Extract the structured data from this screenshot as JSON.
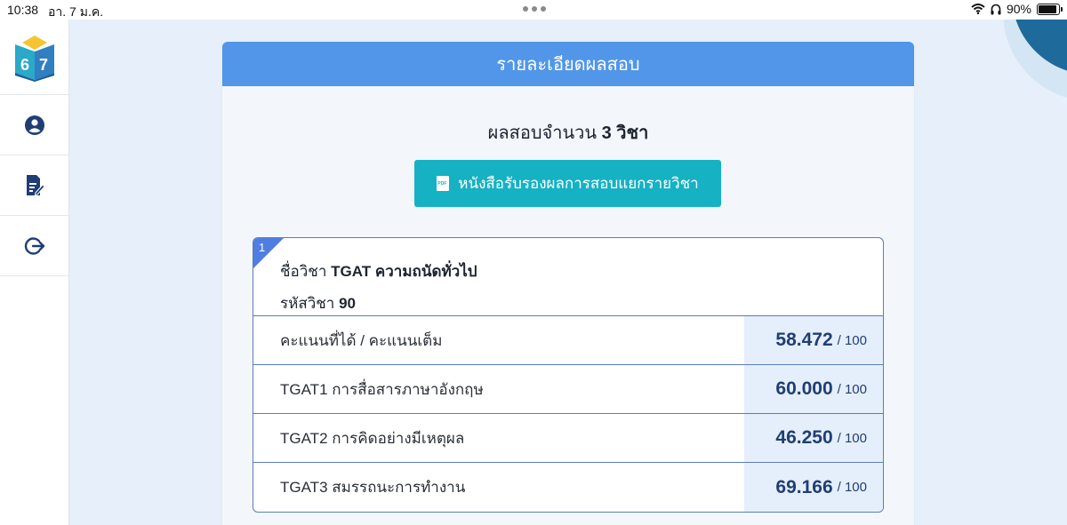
{
  "status_bar": {
    "time": "10:38",
    "date": "อา. 7 ม.ค.",
    "battery": "90%"
  },
  "sidebar": {
    "logo_digits": [
      "6",
      "7"
    ],
    "items": [
      {
        "icon": "user-circle-icon"
      },
      {
        "icon": "document-edit-icon"
      },
      {
        "icon": "logout-icon"
      }
    ]
  },
  "card": {
    "title": "รายละเอียดผลสอบ",
    "subject_count_prefix": "ผลสอบจำนวน",
    "subject_count_value": "3 วิชา",
    "certificate_button": "หนังสือรับรองผลการสอบแยกรายวิชา"
  },
  "result": {
    "index": "1",
    "name_label": "ชื่อวิชา",
    "name_value": "TGAT ความถนัดทั่วไป",
    "code_label": "รหัสวิชา",
    "code_value": "90",
    "rows": [
      {
        "label": "คะแนนที่ได้ / คะแนนเต็ม",
        "score": "58.472",
        "full": "/ 100"
      },
      {
        "label": "TGAT1 การสื่อสารภาษาอังกฤษ",
        "score": "60.000",
        "full": "/ 100"
      },
      {
        "label": "TGAT2 การคิดอย่างมีเหตุผล",
        "score": "46.250",
        "full": "/ 100"
      },
      {
        "label": "TGAT3 สมรรถนะการทำงาน",
        "score": "69.166",
        "full": "/ 100"
      }
    ]
  },
  "colors": {
    "header": "#5196e8",
    "button": "#16b1c3",
    "accent": "#1f3e73"
  }
}
